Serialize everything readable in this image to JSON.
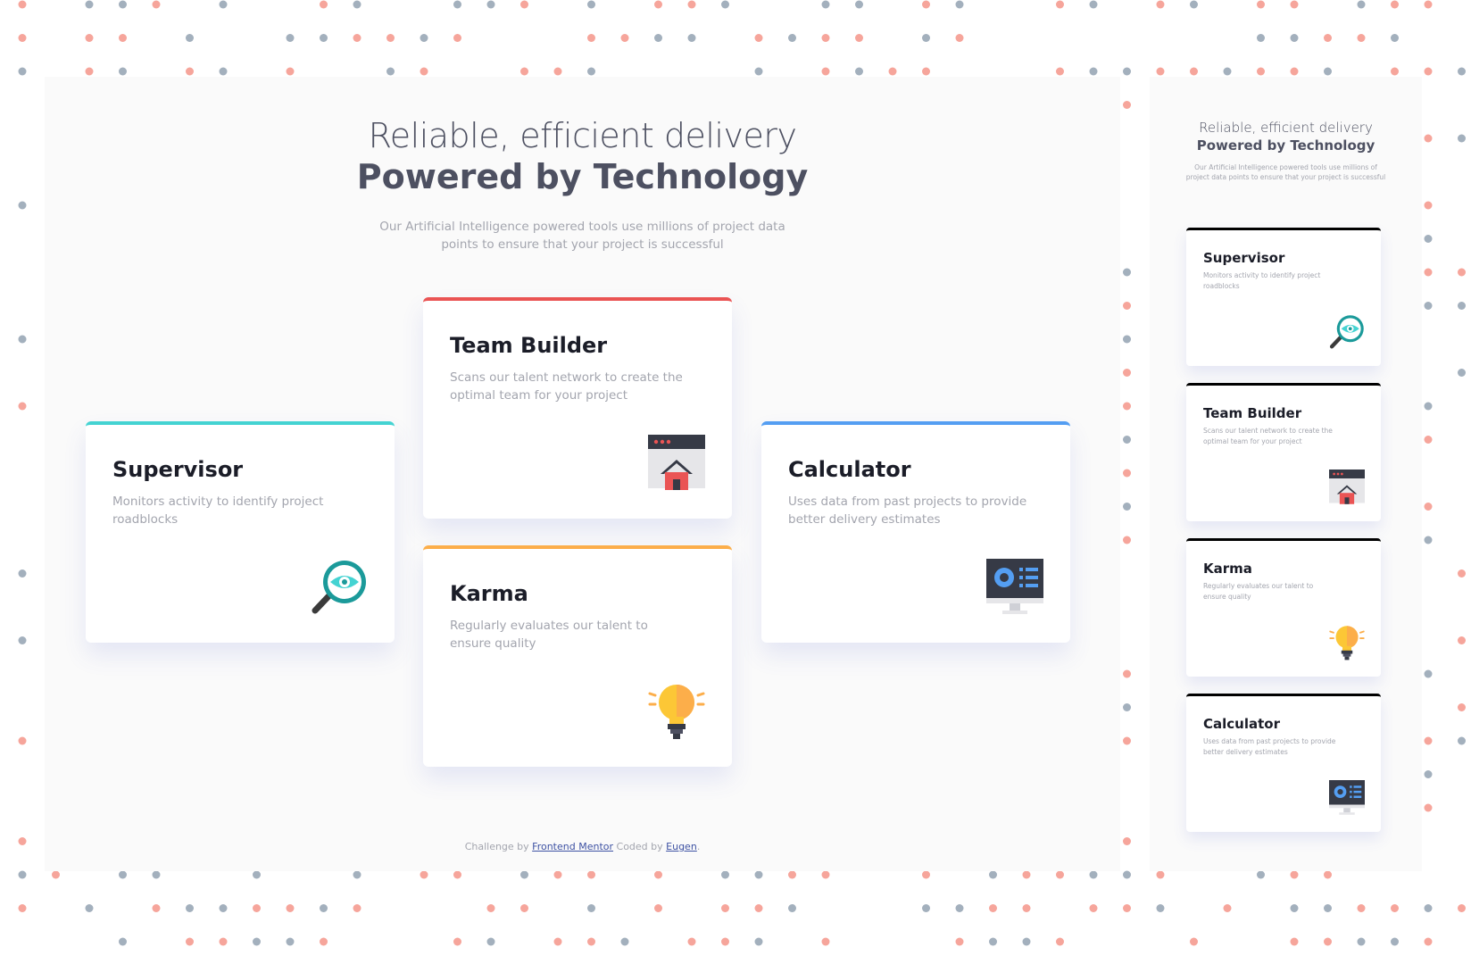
{
  "hero": {
    "line1": "Reliable, efficient delivery",
    "line2": "Powered by Technology",
    "description": "Our Artificial Intelligence powered tools use millions of project data points to ensure that your project is successful"
  },
  "cards": [
    {
      "title": "Supervisor",
      "text": "Monitors activity to identify project roadblocks",
      "icon": "magnifier-eye-icon",
      "accent": "#44d3d2"
    },
    {
      "title": "Team Builder",
      "text": "Scans our talent network to create the optimal team for your project",
      "icon": "team-builder-icon",
      "accent": "#ea5454"
    },
    {
      "title": "Karma",
      "text": "Regularly evaluates our talent to ensure quality",
      "icon": "lightbulb-icon",
      "accent": "#fcae4a"
    },
    {
      "title": "Calculator",
      "text": "Uses data from past projects to provide better delivery estimates",
      "icon": "monitor-calculator-icon",
      "accent": "#549ef2"
    }
  ],
  "attribution": {
    "prefix": "Challenge by",
    "link1": "Frontend Mentor",
    "middle": "Coded by",
    "link2": "Eugen",
    "suffix": "."
  },
  "colors": {
    "dot_red": "#f6a59b",
    "dot_gray": "#a3b0bd",
    "text_dark": "#4d5061",
    "text_muted": "#a3a5ae"
  }
}
